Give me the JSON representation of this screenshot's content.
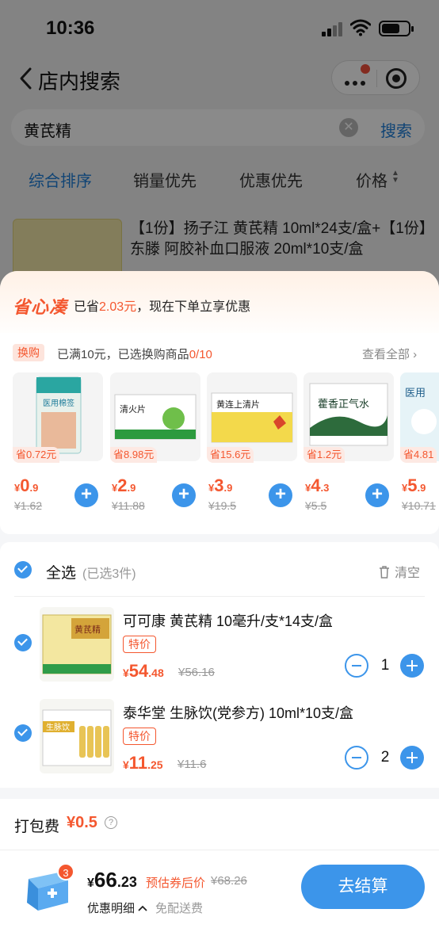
{
  "status_bar": {
    "time": "10:36"
  },
  "nav": {
    "title": "店内搜索"
  },
  "search": {
    "query": "黄芪精",
    "clear_icon": "clear-icon",
    "search_label": "搜索"
  },
  "sort_tabs": [
    {
      "label": "综合排序",
      "active": true
    },
    {
      "label": "销量优先",
      "active": false
    },
    {
      "label": "优惠优先",
      "active": false
    },
    {
      "label": "价格",
      "active": false
    }
  ],
  "background_product": {
    "title": "【1份】扬子江 黄芪精 10ml*24支/盒+【1份】东滕 阿胶补血口服液 20ml*10支/盒"
  },
  "promo": {
    "logo": "省心凑",
    "text_before": "已省",
    "saved_amount": "2.03元",
    "text_after": "，现在下单立享优惠"
  },
  "exchange": {
    "tag": "换购",
    "condition_before": "已满10元，已选换购商品",
    "condition_count": "0/10",
    "view_all": "查看全部",
    "items": [
      {
        "name": "医用棉签",
        "save": "省0.72元",
        "price_int": "0",
        "price_dec": ".9",
        "orig": "¥1.62"
      },
      {
        "name": "清火片",
        "save": "省8.98元",
        "price_int": "2",
        "price_dec": ".9",
        "orig": "¥11.88"
      },
      {
        "name": "黄连上清片",
        "save": "省15.6元",
        "price_int": "3",
        "price_dec": ".9",
        "orig": "¥19.5"
      },
      {
        "name": "藿香正气水",
        "save": "省1.2元",
        "price_int": "4",
        "price_dec": ".3",
        "orig": "¥5.5"
      },
      {
        "name": "医用",
        "save": "省4.81",
        "price_int": "5",
        "price_dec": ".9",
        "orig": "¥10.71"
      }
    ]
  },
  "cart": {
    "select_all": "全选",
    "selected_count": "(已选3件)",
    "clear": "清空",
    "items": [
      {
        "name": "可可康 黄芪精 10毫升/支*14支/盒",
        "tag": "特价",
        "price_int": "54",
        "price_dec": ".48",
        "orig": "¥56.16",
        "qty": "1",
        "box_text": "黄芪精"
      },
      {
        "name": "泰华堂 生脉饮(党参方) 10ml*10支/盒",
        "tag": "特价",
        "price_int": "11",
        "price_dec": ".25",
        "orig": "¥11.6",
        "qty": "2",
        "box_text": "生脉饮"
      }
    ]
  },
  "packaging": {
    "label": "打包费",
    "fee": "¥0.5"
  },
  "checkout": {
    "badge": "3",
    "total_int": "66",
    "total_dec": ".23",
    "est_label": "预估券后价",
    "est_orig": "¥68.26",
    "detail_label": "优惠明细",
    "free_shipping": "免配送费",
    "pay_button": "去结算"
  },
  "colors": {
    "accent": "#3c95ea",
    "price_red": "#f4572f"
  }
}
